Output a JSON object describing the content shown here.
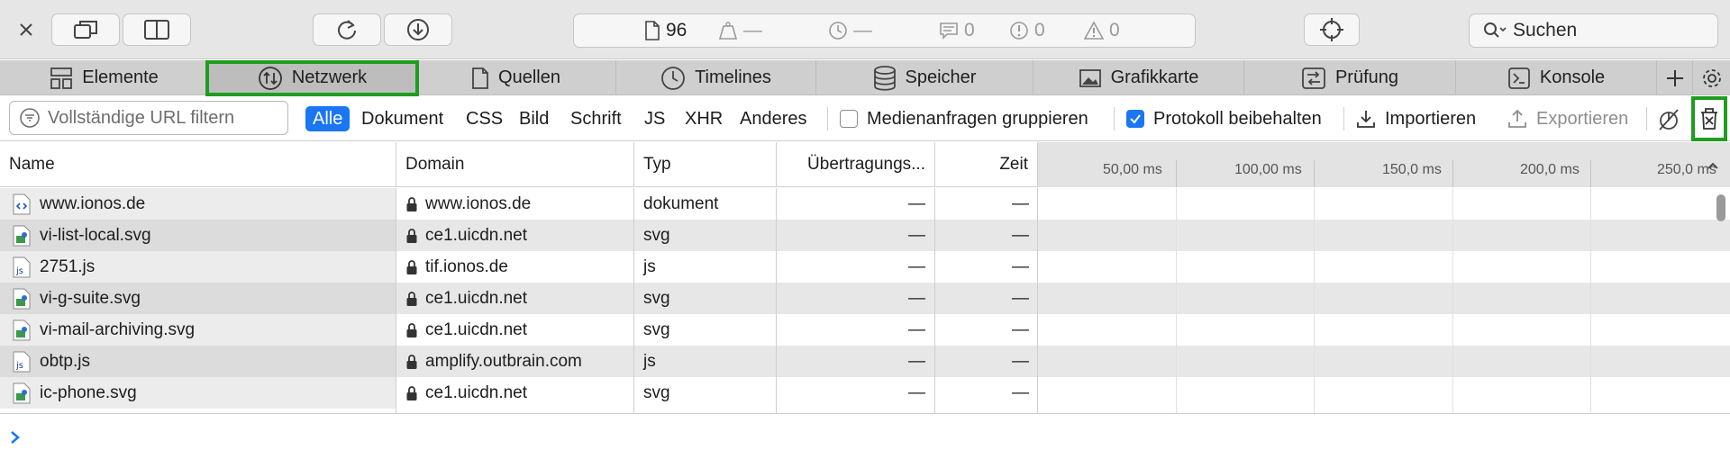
{
  "toolbar": {
    "resource_count": "96",
    "errors_placeholder": "—",
    "time_placeholder": "—",
    "messages": "0",
    "errors": "0",
    "warnings": "0",
    "search_label": "Suchen"
  },
  "tabs": [
    {
      "label": "Elemente",
      "icon": "layout-icon"
    },
    {
      "label": "Netzwerk",
      "icon": "network-icon",
      "active": true
    },
    {
      "label": "Quellen",
      "icon": "document-icon"
    },
    {
      "label": "Timelines",
      "icon": "clock-icon"
    },
    {
      "label": "Speicher",
      "icon": "database-icon"
    },
    {
      "label": "Grafikkarte",
      "icon": "image-icon"
    },
    {
      "label": "Prüfung",
      "icon": "audit-icon"
    },
    {
      "label": "Konsole",
      "icon": "console-icon"
    }
  ],
  "filter": {
    "placeholder": "Vollständige URL filtern",
    "types": [
      "Alle",
      "Dokument",
      "CSS",
      "Bild",
      "Schrift",
      "JS",
      "XHR",
      "Anderes"
    ],
    "group_media": "Medienanfragen gruppieren",
    "preserve_log": "Protokoll beibehalten",
    "import": "Importieren",
    "export": "Exportieren"
  },
  "columns": {
    "name": "Name",
    "domain": "Domain",
    "type": "Typ",
    "transfer": "Übertragungs...",
    "time": "Zeit"
  },
  "waterfall_ticks": [
    "50,00 ms",
    "100,00 ms",
    "150,0 ms",
    "200,0 ms",
    "250,0 ms"
  ],
  "rows": [
    {
      "name": "www.ionos.de",
      "domain": "www.ionos.de",
      "type": "dokument",
      "transfer": "—",
      "time": "—",
      "kind": "html"
    },
    {
      "name": "vi-list-local.svg",
      "domain": "ce1.uicdn.net",
      "type": "svg",
      "transfer": "—",
      "time": "—",
      "kind": "img"
    },
    {
      "name": "2751.js",
      "domain": "tif.ionos.de",
      "type": "js",
      "transfer": "—",
      "time": "—",
      "kind": "js"
    },
    {
      "name": "vi-g-suite.svg",
      "domain": "ce1.uicdn.net",
      "type": "svg",
      "transfer": "—",
      "time": "—",
      "kind": "img"
    },
    {
      "name": "vi-mail-archiving.svg",
      "domain": "ce1.uicdn.net",
      "type": "svg",
      "transfer": "—",
      "time": "—",
      "kind": "img"
    },
    {
      "name": "obtp.js",
      "domain": "amplify.outbrain.com",
      "type": "js",
      "transfer": "—",
      "time": "—",
      "kind": "js"
    },
    {
      "name": "ic-phone.svg",
      "domain": "ce1.uicdn.net",
      "type": "svg",
      "transfer": "—",
      "time": "—",
      "kind": "img"
    }
  ],
  "colors": {
    "accent": "#1a76f2",
    "highlight": "#1f9d1f"
  }
}
